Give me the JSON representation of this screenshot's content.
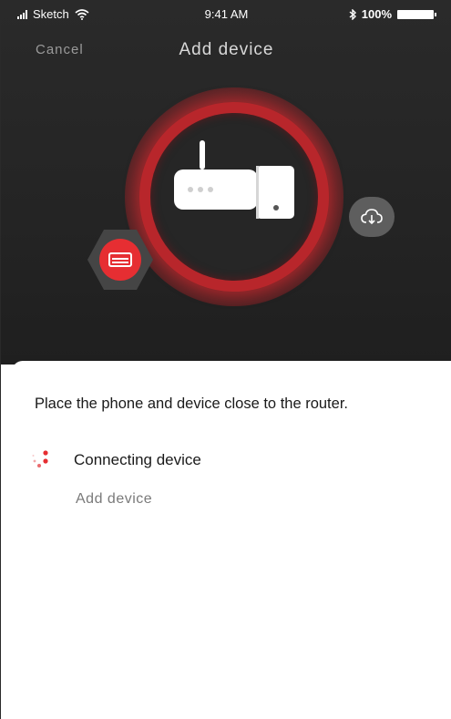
{
  "status_bar": {
    "carrier": "Sketch",
    "time": "9:41 AM",
    "battery": "100%"
  },
  "nav": {
    "cancel_label": "Cancel",
    "title": "Add device"
  },
  "icons": {
    "signal": "signal-icon",
    "wifi": "wifi-icon",
    "bluetooth": "bluetooth-icon",
    "battery": "battery-icon",
    "router": "router-icon",
    "cloud": "cloud-download-icon",
    "device": "air-conditioner-icon",
    "spinner": "loading-dots-icon"
  },
  "colors": {
    "accent": "#e62e32",
    "ring": "#b8262b",
    "background_dark": "#262626",
    "text_dark": "#1a1a1a",
    "text_muted": "#7a7a7a"
  },
  "sheet": {
    "instruction": "Place the phone and device close to the router.",
    "steps": [
      {
        "label": "Connecting device",
        "state": "in-progress"
      },
      {
        "label": "Add device",
        "state": "pending"
      }
    ]
  }
}
